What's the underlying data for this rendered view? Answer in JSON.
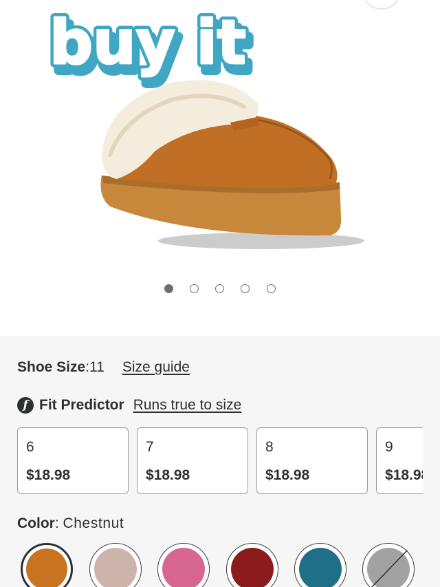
{
  "sticker_text": "buy it",
  "carousel": {
    "slides": 5,
    "active_index": 0
  },
  "shoe_size": {
    "label": "Shoe Size",
    "separator": ": ",
    "value": "11",
    "guide_link": "Size guide"
  },
  "fit_predictor": {
    "icon": "f-logo-icon",
    "label": "Fit Predictor",
    "result_link": "Runs true to size"
  },
  "size_options": [
    {
      "size": "6",
      "price": "$18.98"
    },
    {
      "size": "7",
      "price": "$18.98"
    },
    {
      "size": "8",
      "price": "$18.98"
    },
    {
      "size": "9",
      "price": "$18.98"
    }
  ],
  "color": {
    "label": "Color",
    "separator": ": ",
    "value": "Chestnut"
  },
  "swatches": [
    {
      "name": "chestnut",
      "color": "#c8731f",
      "selected": true,
      "unavailable": false
    },
    {
      "name": "blush",
      "color": "#cdb4aa",
      "selected": false,
      "unavailable": false
    },
    {
      "name": "pink",
      "color": "#d76690",
      "selected": false,
      "unavailable": false
    },
    {
      "name": "burgundy",
      "color": "#8c1c1c",
      "selected": false,
      "unavailable": false
    },
    {
      "name": "teal",
      "color": "#1f6f86",
      "selected": false,
      "unavailable": false
    },
    {
      "name": "grey",
      "color": "#a2a2a2",
      "selected": false,
      "unavailable": true
    }
  ],
  "colors": {
    "text": "#2e2f32",
    "panel_bg": "#f6f6f6",
    "sticker_teal": "#3fa7c4",
    "dot_grey": "#6d6e71"
  }
}
